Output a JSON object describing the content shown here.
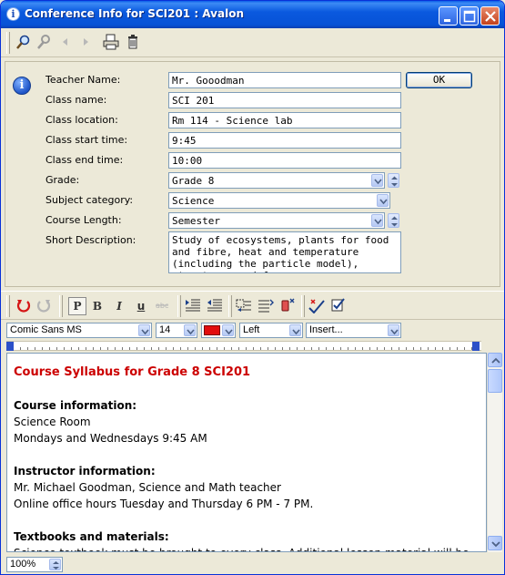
{
  "window": {
    "title": "Conference Info for SCI201 : Avalon"
  },
  "form": {
    "fields": [
      {
        "label": "Teacher Name:",
        "value": "Mr. Gooodman"
      },
      {
        "label": "Class name:",
        "value": "SCI 201"
      },
      {
        "label": "Class location:",
        "value": "Rm 114 - Science lab"
      },
      {
        "label": "Class start time:",
        "value": "9:45"
      },
      {
        "label": "Class end time:",
        "value": "10:00"
      },
      {
        "label": "Grade:",
        "value": "Grade 8"
      },
      {
        "label": "Subject category:",
        "value": "Science"
      },
      {
        "label": "Course Length:",
        "value": "Semester"
      },
      {
        "label": "Short Description:",
        "value": "Study of ecosystems, plants for food and fibre, heat and temperature (including the particle model), structures and forces"
      }
    ],
    "ok_label": "OK"
  },
  "format_toolbar": {
    "font": "Comic Sans MS",
    "size": "14",
    "color": "#e20d0d",
    "align": "Left",
    "insert": "Insert...",
    "buttons": {
      "p": "P",
      "b": "B",
      "i": "I",
      "u": "u"
    }
  },
  "document": {
    "title": "Course Syllabus for Grade 8 SCI201",
    "sections": [
      {
        "heading": "Course information:",
        "lines": [
          "Science Room",
          "Mondays and Wednesdays 9:45 AM"
        ]
      },
      {
        "heading": "Instructor information:",
        "lines": [
          "Mr. Michael Goodman, Science and Math teacher",
          "Online office hours Tuesday and Thursday 6 PM - 7 PM."
        ]
      },
      {
        "heading": "Textbooks and materials:",
        "lines": [
          "Science textbook must be brought to every class. Additional lesson material will be"
        ]
      }
    ]
  },
  "status": {
    "zoom": "100%"
  },
  "colors": {
    "title_bar": "#0a59df",
    "doc_title": "#cc0000"
  }
}
